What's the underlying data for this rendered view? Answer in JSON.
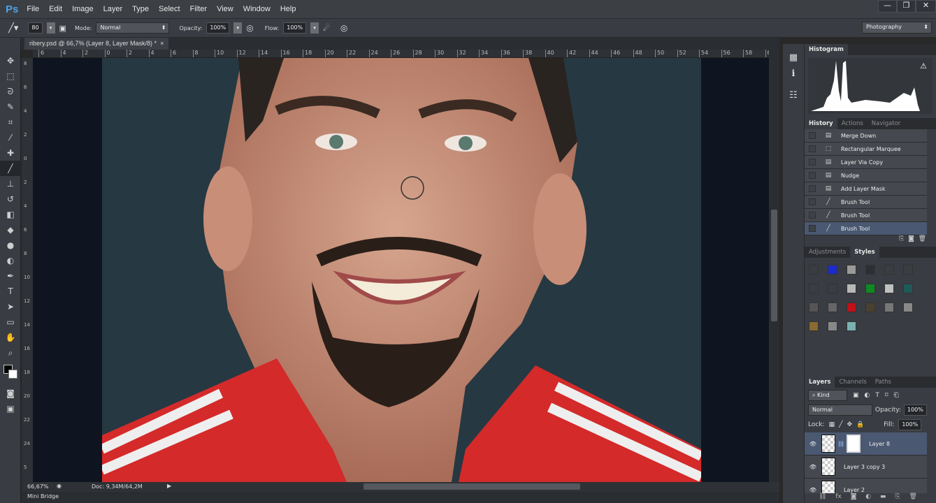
{
  "app": {
    "logo": "Ps",
    "menu": [
      "File",
      "Edit",
      "Image",
      "Layer",
      "Type",
      "Select",
      "Filter",
      "View",
      "Window",
      "Help"
    ],
    "window_controls": [
      "minimize",
      "restore",
      "close"
    ]
  },
  "options": {
    "brush_size": "80",
    "mode_label": "Mode:",
    "mode": "Normal",
    "opacity_label": "Opacity:",
    "opacity": "100%",
    "flow_label": "Flow:",
    "flow": "100%",
    "workspace": "Photography"
  },
  "document": {
    "tab_title": "ribery.psd @ 66,7% (Layer 8, Layer Mask/8) *",
    "close": "×",
    "ruler_labels": [
      "6",
      "4",
      "2",
      "0",
      "2",
      "4",
      "6",
      "8",
      "10",
      "12",
      "14",
      "16",
      "18",
      "20",
      "22",
      "24",
      "26",
      "28",
      "30",
      "32",
      "34",
      "36",
      "38",
      "40",
      "42",
      "44",
      "46",
      "48",
      "50",
      "52",
      "54",
      "56",
      "58",
      "6"
    ],
    "vruler_labels": [
      "8",
      "6",
      "4",
      "2",
      "0",
      "2",
      "4",
      "6",
      "8",
      "10",
      "12",
      "14",
      "16",
      "18",
      "20",
      "22",
      "24",
      "5"
    ]
  },
  "status": {
    "zoom": "66,67%",
    "doc": "Doc: 9,34M/64,2M"
  },
  "mini_bridge": "Mini Bridge",
  "histogram": {
    "title": "Histogram",
    "warning": "⚠"
  },
  "history": {
    "tabs": [
      "History",
      "Actions",
      "Navigator"
    ],
    "items": [
      {
        "label": "Merge Down",
        "icon": "▤"
      },
      {
        "label": "Rectangular Marquee",
        "icon": "⬚"
      },
      {
        "label": "Layer Via Copy",
        "icon": "▤"
      },
      {
        "label": "Nudge",
        "icon": "▤"
      },
      {
        "label": "Add Layer Mask",
        "icon": "▤"
      },
      {
        "label": "Brush Tool",
        "icon": "╱"
      },
      {
        "label": "Brush Tool",
        "icon": "╱"
      },
      {
        "label": "Brush Tool",
        "icon": "╱"
      }
    ],
    "selected_index": 7
  },
  "styles": {
    "tabs": [
      "Adjustments",
      "Styles"
    ],
    "swatches": [
      "#3a3d42",
      "#1a2bd0",
      "#9a9a9a",
      "#2c2f34",
      "#3a3d42",
      "#3a3d42",
      "#3a3d42",
      "#3a3d42",
      "#b8b8b8",
      "#0e8a22",
      "#c0c0c0",
      "#1e5a5a",
      "#555",
      "#666",
      "#c0101a",
      "#4a4030",
      "#777",
      "#888",
      "#8a6a30",
      "#888",
      "#7ab0b0"
    ]
  },
  "layers": {
    "tabs": [
      "Layers",
      "Channels",
      "Paths"
    ],
    "filter": "Kind",
    "blend": "Normal",
    "opacity_label": "Opacity:",
    "opacity": "100%",
    "lock_label": "Lock:",
    "fill_label": "Fill:",
    "fill": "100%",
    "items": [
      {
        "name": "Layer 8",
        "selected": true
      },
      {
        "name": "Layer 3 copy 3",
        "selected": false
      },
      {
        "name": "Layer 2",
        "selected": false
      }
    ]
  }
}
